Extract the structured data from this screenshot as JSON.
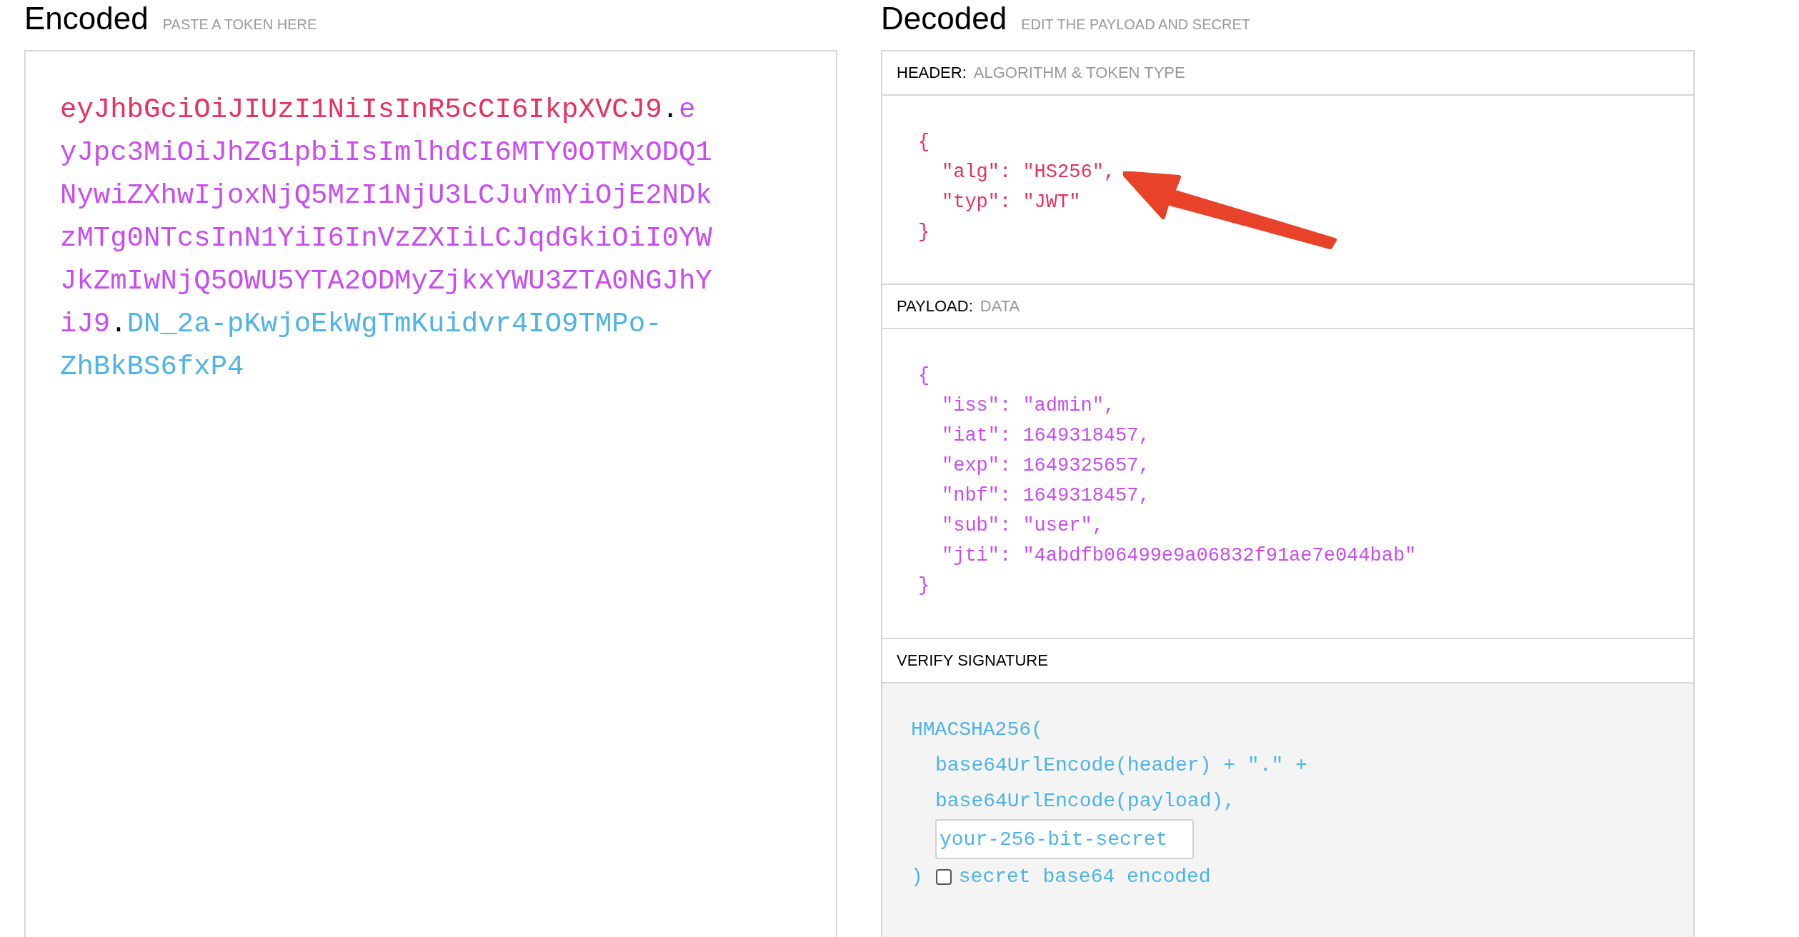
{
  "encoded": {
    "title": "Encoded",
    "subtitle": "PASTE A TOKEN HERE",
    "token_parts": [
      {
        "kind": "header",
        "text": "eyJhbGciOiJIUzI1NiIsInR5cCI6IkpXVCJ9"
      },
      {
        "kind": "dot",
        "text": "."
      },
      {
        "kind": "payload",
        "text": "eyJpc3MiOiJhZG1pbiIsImlhdCI6MTY0OTMxODQ1NywiZXhwIjoxNjQ5MzI1NjU3LCJuYmYiOjE2NDkzMTg0NTcsInN1YiI6InVzZXIiLCJqdGkiOiI0YWJkZmIwNjQ5OWU5YTA2ODMyZjkxYWU3ZTA0NGJhYiJ9"
      },
      {
        "kind": "dot",
        "text": "."
      },
      {
        "kind": "signature",
        "text": "DN_2a-pKwjoEkWgTmKuidvr4IO9TMPo-ZhBkBS6fxP4"
      }
    ]
  },
  "decoded": {
    "title": "Decoded",
    "subtitle": "EDIT THE PAYLOAD AND SECRET",
    "sections": [
      {
        "kind": "header",
        "label": "HEADER:",
        "sublabel": "ALGORITHM & TOKEN TYPE",
        "lines": [
          {
            "kind": "brace",
            "text": "{"
          },
          {
            "kind": "entry",
            "text": "\"alg\": \"HS256\","
          },
          {
            "kind": "entry",
            "text": "\"typ\": \"JWT\""
          },
          {
            "kind": "brace",
            "text": "}"
          }
        ]
      },
      {
        "kind": "payload",
        "label": "PAYLOAD:",
        "sublabel": "DATA",
        "lines": [
          {
            "kind": "brace",
            "text": "{"
          },
          {
            "kind": "entry",
            "text": "\"iss\": \"admin\","
          },
          {
            "kind": "entry",
            "text": "\"iat\": 1649318457,"
          },
          {
            "kind": "entry",
            "text": "\"exp\": 1649325657,"
          },
          {
            "kind": "entry",
            "text": "\"nbf\": 1649318457,"
          },
          {
            "kind": "entry",
            "text": "\"sub\": \"user\","
          },
          {
            "kind": "entry",
            "text": "\"jti\": \"4abdfb06499e9a06832f91ae7e044bab\""
          },
          {
            "kind": "brace",
            "text": "}"
          }
        ]
      },
      {
        "kind": "verify",
        "label": "VERIFY SIGNATURE",
        "function": "HMACSHA256(",
        "args": [
          "base64UrlEncode(header) + \".\" +",
          "base64UrlEncode(payload),"
        ],
        "secret": "your-256-bit-secret",
        "close": ")",
        "base64_checkbox": {
          "label": "secret base64 encoded",
          "checked": false
        }
      }
    ]
  }
}
